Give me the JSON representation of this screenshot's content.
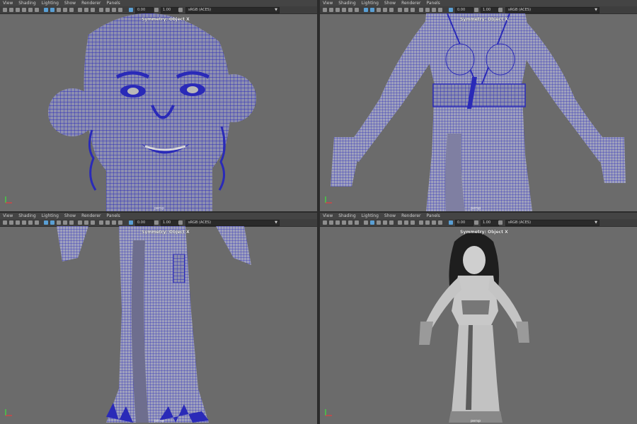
{
  "menu": [
    "View",
    "Shading",
    "Lighting",
    "Show",
    "Renderer",
    "Panels"
  ],
  "panels": [
    {
      "symmetry": "Symmetry: Object X",
      "camera": "persp",
      "exposure": "0.00",
      "gamma": "1.00",
      "colorspace": "sRGB (ACES)"
    },
    {
      "symmetry": "Symmetry: Object X",
      "camera": "persp",
      "exposure": "0.00",
      "gamma": "1.00",
      "colorspace": "sRGB (ACES)"
    },
    {
      "symmetry": "Symmetry: Object X",
      "camera": "persp",
      "exposure": "0.00",
      "gamma": "1.00",
      "colorspace": "sRGB (ACES)"
    },
    {
      "symmetry": "Symmetry: Object X",
      "camera": "persp",
      "exposure": "0.00",
      "gamma": "1.00",
      "colorspace": "sRGB (ACES)"
    }
  ],
  "colors": {
    "viewport_bg": "#6b6b6b",
    "wireframe": "#2a2ab8",
    "wire_bg": "#3b3ba0",
    "shaded": "#c8c8c8"
  }
}
